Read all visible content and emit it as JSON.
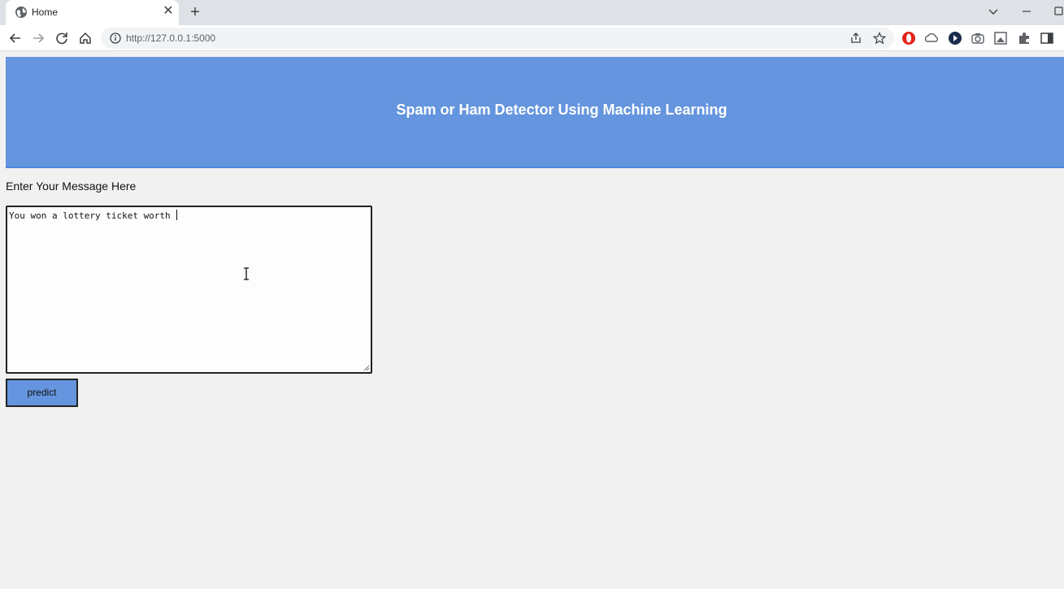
{
  "browser": {
    "tab_title": "Home",
    "url": "http://127.0.0.1:5000"
  },
  "page": {
    "heading": "Spam or Ham Detector Using Machine Learning",
    "message_label": "Enter Your Message Here",
    "message_value": "You won a lottery ticket worth ",
    "predict_label": "predict"
  },
  "colors": {
    "header_bg": "#6495de",
    "page_bg": "#f2f1f1",
    "button_bg": "#6495de"
  },
  "icons": [
    "globe-icon",
    "close-icon",
    "plus-icon",
    "back-icon",
    "forward-icon",
    "reload-icon",
    "home-icon",
    "info-icon",
    "share-icon",
    "star-icon",
    "puzzle-icon",
    "sidepanel-icon"
  ]
}
